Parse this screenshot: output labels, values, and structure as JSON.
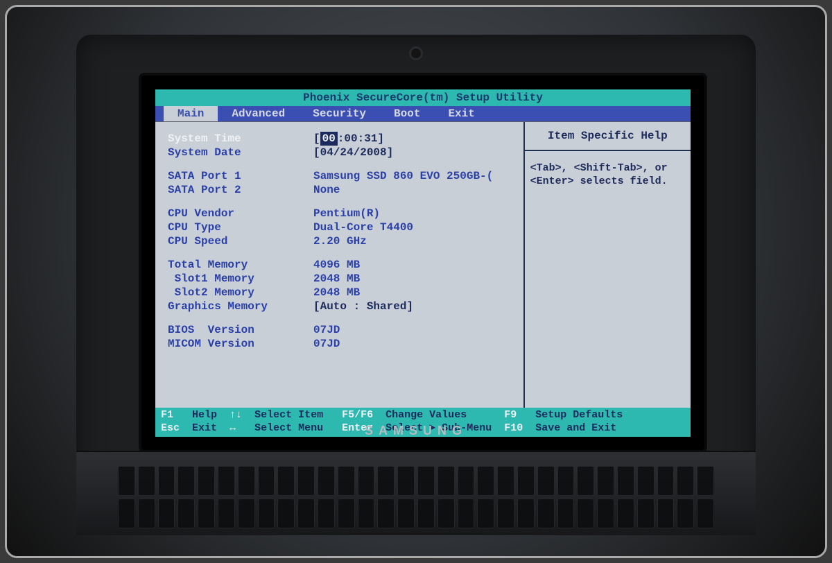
{
  "title": "Phoenix SecureCore(tm) Setup Utility",
  "menu": {
    "items": [
      "Main",
      "Advanced",
      "Security",
      "Boot",
      "Exit"
    ],
    "active_index": 0
  },
  "fields": {
    "system_time": {
      "label": "System Time",
      "hours": "00",
      "rest": ":00:31]"
    },
    "system_date": {
      "label": "System Date",
      "value": "[04/24/2008]"
    },
    "sata1": {
      "label": "SATA Port 1",
      "value": "Samsung SSD 860 EVO 250GB-("
    },
    "sata2": {
      "label": "SATA Port 2",
      "value": "None"
    },
    "cpu_vendor": {
      "label": "CPU Vendor",
      "value": "Pentium(R)"
    },
    "cpu_type": {
      "label": "CPU Type",
      "value": "Dual-Core T4400"
    },
    "cpu_speed": {
      "label": "CPU Speed",
      "value": "2.20 GHz"
    },
    "total_mem": {
      "label": "Total Memory",
      "value": "4096 MB"
    },
    "slot1_mem": {
      "label": " Slot1 Memory",
      "value": "2048 MB"
    },
    "slot2_mem": {
      "label": " Slot2 Memory",
      "value": "2048 MB"
    },
    "gfx_mem": {
      "label": "Graphics Memory",
      "value": "[Auto : Shared]"
    },
    "bios_ver": {
      "label": "BIOS  Version",
      "value": "07JD"
    },
    "micom_ver": {
      "label": "MICOM Version",
      "value": "07JD"
    }
  },
  "help": {
    "title": "Item Specific Help",
    "body": "<Tab>, <Shift-Tab>, or <Enter> selects field."
  },
  "footer": {
    "r1": {
      "k1": "F1",
      "t1": "Help",
      "k2": "↑↓",
      "t2": "Select Item",
      "k3": "F5/F6",
      "t3": "Change Values",
      "k4": "F9",
      "t4": "Setup Defaults"
    },
    "r2": {
      "k1": "Esc",
      "t1": "Exit",
      "k2": "↔",
      "t2": "Select Menu",
      "k3": "Enter",
      "t3": "Select ► Sub-Menu",
      "k4": "F10",
      "t4": "Save and Exit"
    }
  },
  "brand": "SAMSUNG"
}
